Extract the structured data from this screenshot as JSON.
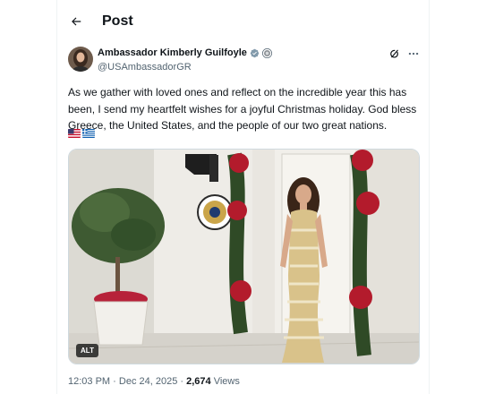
{
  "header": {
    "title": "Post",
    "back_icon": "arrow-left-icon"
  },
  "author": {
    "name": "Ambassador Kimberly Guilfoyle",
    "handle": "@USAmbassadorGR",
    "verified_badge": "verified-check-icon",
    "affiliate_badge": "government-seal-icon"
  },
  "actions": {
    "grok_icon": "grok-icon",
    "more_icon": "more-horizontal-icon"
  },
  "post": {
    "text": "As we gather with loved ones and reflect on the incredible year this has been, I send my heartfelt wishes for a joyful Christmas holiday. God bless Greece, the United States, and the people of our two great nations.",
    "flags": [
      "us-flag",
      "greece-flag"
    ],
    "media": {
      "alt_label": "ALT",
      "description_icon": "photo"
    }
  },
  "meta": {
    "time": "12:03 PM",
    "separator": "·",
    "date": "Dec 24, 2025",
    "views_count": "2,674",
    "views_label": "Views"
  },
  "colors": {
    "text": "#0f1419",
    "secondary": "#536471",
    "verified": "#1d9bf0",
    "border": "#eff3f4"
  }
}
